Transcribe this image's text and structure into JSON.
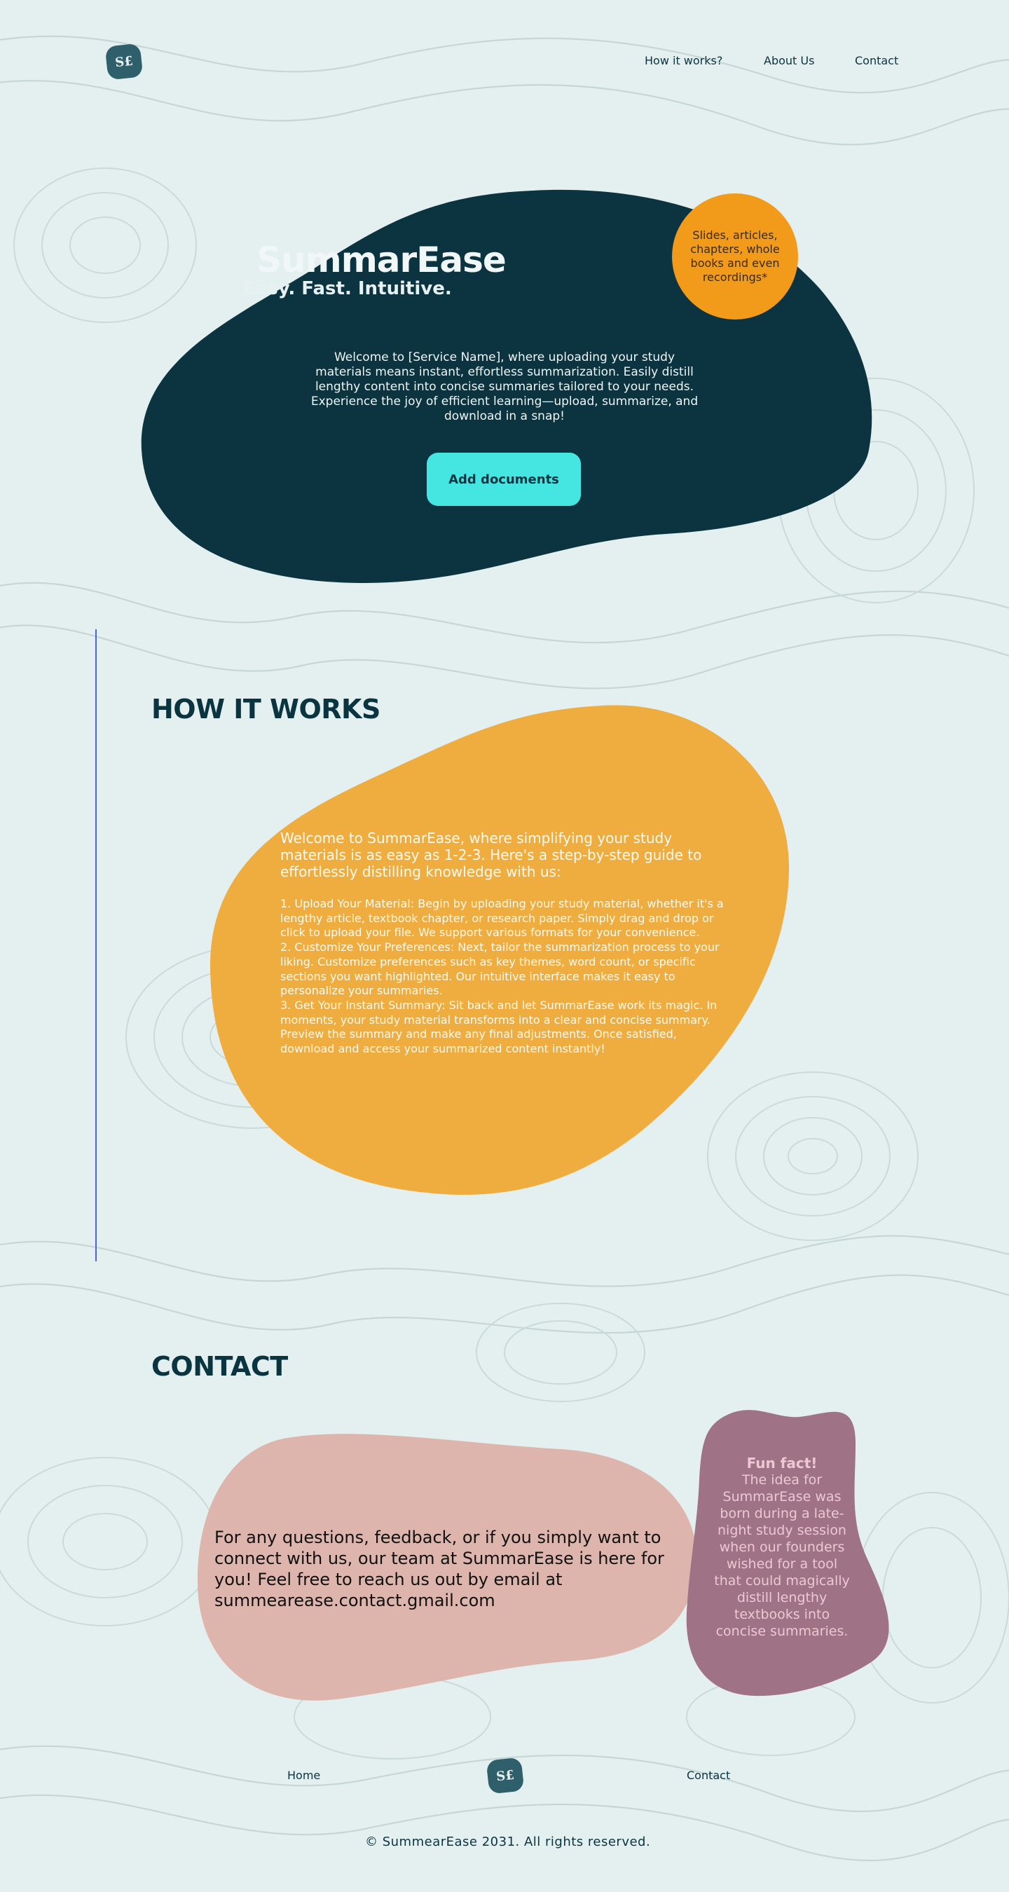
{
  "brand": {
    "logo_text": "S£",
    "name": "SummarEase",
    "tagline": "Easy. Fast. Intuitive."
  },
  "nav": {
    "items": [
      "How it works?",
      "About Us",
      "Contact"
    ]
  },
  "hero": {
    "description": "Welcome to [Service Name], where uploading your study materials means instant, effortless summarization. Easily distill lengthy content into concise summaries tailored to your needs. Experience the joy of efficient learning—upload, summarize, and download in a snap!",
    "cta_label": "Add documents",
    "badge_text": "Slides, articles, chapters, whole books and even recordings*"
  },
  "how_it_works": {
    "title": "HOW IT WORKS",
    "intro": "Welcome to SummarEase, where simplifying your study materials is as easy as 1-2-3. Here's a step-by-step guide to effortlessly distilling knowledge with us:",
    "steps": [
      "1. Upload Your Material: Begin by uploading your study material, whether it's a lengthy article, textbook chapter, or research paper. Simply drag and drop or click to upload your file. We support various formats for your convenience.",
      "2. Customize Your Preferences: Next, tailor the summarization process to your liking. Customize preferences such as key themes, word count, or specific sections you want highlighted. Our intuitive interface makes it easy to personalize your summaries.",
      "3. Get Your Instant Summary: Sit back and let SummarEase work its magic. In moments, your study material transforms into a clear and concise summary. Preview the summary and make any final adjustments. Once satisfied, download and access your summarized content instantly!"
    ]
  },
  "contact": {
    "title": "CONTACT",
    "text": "For any questions, feedback, or if you simply want to connect with us, our team at SummarEase is here for you! Feel free to reach us out by email at summearease.contact.gmail.com",
    "fun_fact_title": "Fun fact!",
    "fun_fact_text": "The idea for SummarEase was born during a late-night study session when our founders wished for a tool that could magically distill lengthy textbooks into concise summaries."
  },
  "footer": {
    "home": "Home",
    "contact": "Contact",
    "copyright": "© SummearEase 2031. All rights reserved."
  },
  "colors": {
    "background": "#e4eff0",
    "dark_teal": "#0b3440",
    "accent_cyan": "#45e6e1",
    "orange": "#f29a1a",
    "amber": "#f0ad3f",
    "rose": "#ddb5ac",
    "mauve": "#a07286"
  }
}
